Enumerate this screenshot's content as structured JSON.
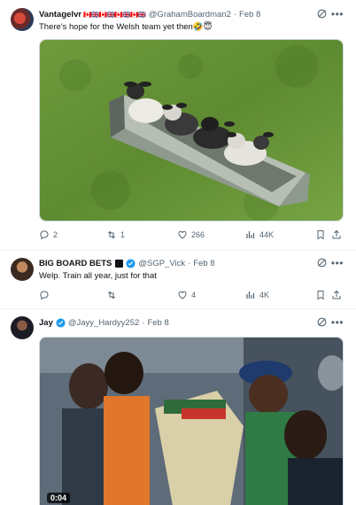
{
  "tweets": [
    {
      "display_name": "Vantagelvr",
      "flags": "🇨🇦🇬🇧🇨🇦🇬🇧🇨🇦🇬🇧🇨🇦🇬🇧",
      "handle": "@GrahamBoardman2",
      "separator": "·",
      "time": "Feb 8",
      "text": "There's hope for the Welsh team yet then🤣😇",
      "media": "image",
      "stats": {
        "replies": "2",
        "retweets": "1",
        "likes": "266",
        "views": "44K"
      }
    },
    {
      "display_name": "BIG BOARD BETS",
      "handle": "@SGP_Vick",
      "separator": "·",
      "time": "Feb 8",
      "text": "Welp. Train all year, just for that",
      "stats": {
        "replies": "",
        "retweets": "",
        "likes": "4",
        "views": "4K"
      }
    },
    {
      "display_name": "Jay",
      "handle": "@Jayy_Hardyy252",
      "separator": "·",
      "time": "Feb 8",
      "media": "video",
      "video_duration": "0:04"
    }
  ],
  "icons": {
    "more": "more-icon",
    "grok": "grok-icon",
    "reply": "reply-icon",
    "retweet": "retweet-icon",
    "like": "like-icon",
    "views": "views-icon",
    "bookmark": "bookmark-icon",
    "share": "share-icon",
    "verified": "verified-icon"
  },
  "colors": {
    "verified": "#1d9bf0",
    "muted": "#536471",
    "text": "#0f1419"
  }
}
